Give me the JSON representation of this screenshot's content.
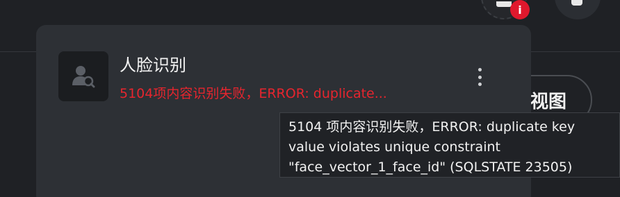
{
  "header": {
    "notification_badge": "i",
    "colors": {
      "badge": "#e0182d"
    }
  },
  "view_button": {
    "label": "视图"
  },
  "card": {
    "title": "人脸识别",
    "error_preview": "5104项内容识别失败，ERROR: duplicate...",
    "colors": {
      "error": "#e6252e",
      "background": "#2d3035"
    }
  },
  "tooltip": {
    "line1": "5104 项内容识别失败，ERROR: duplicate key",
    "line2": "value violates unique constraint",
    "line3": "\"face_vector_1_face_id\" (SQLSTATE 23505)"
  },
  "icons": {
    "avatar": "face-search-icon",
    "more": "more-vertical-icon",
    "mail": "mail-icon",
    "info": "info-icon"
  }
}
